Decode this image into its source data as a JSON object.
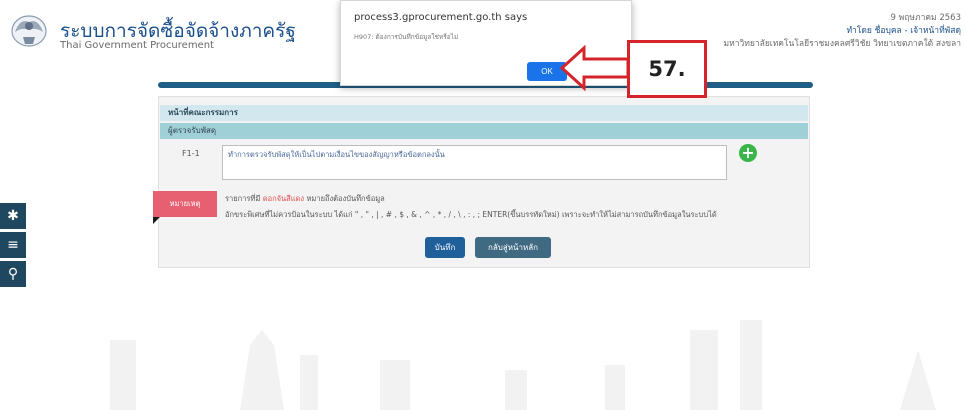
{
  "header": {
    "title": "ระบบการจัดซื้อจัดจ้างภาครัฐ",
    "subtitle": "Thai Government Procurement",
    "date": "9 พฤษภาคม 2563",
    "user": "ทำโดย ชื่อบุคล - เจ้าหน้าที่พัสดุ",
    "org": "มหาวิทยาลัยเทคโนโลยีราชมงคลศรีวิชัย วิทยาเขตภาคใต้ สงขลา"
  },
  "form": {
    "section_title": "หน้าที่คณะกรรมการ",
    "subsection_title": "ผู้ตรวจรับพัสดุ",
    "row_code": "F1-1",
    "duty_text": "ทำการตรวจรับพัสดุให้เป็นไปตามเงื่อนไขของสัญญาหรือข้อตกลงนั้น",
    "note_label": "หมายเหตุ",
    "note_line1_prefix": "รายการที่มี",
    "note_line1_red": "ดอกจันสีแดง",
    "note_line1_suffix": "หมายถึงต้องบันทึกข้อมูล",
    "note_line2": "อักขระพิเศษที่ไม่ควรป้อนในระบบ ได้แก่ \" , \" , | , # , $ , & , ^ , * , / , \\ , : , ; ENTER(ขึ้นบรรทัดใหม่) เพราะจะทำให้ไม่สามารถบันทึกข้อมูลในระบบได้",
    "save_label": "บันทึก",
    "home_label": "กลับสู่หน้าหลัก"
  },
  "dialog": {
    "title": "process3.gprocurement.go.th says",
    "message": "H907: ต้องการบันทึกข้อมูลใช่หรือไม่",
    "ok_label": "OK"
  },
  "annotation": {
    "step_label": "57.",
    "color": "#d6252a"
  },
  "sidebar_icons": [
    "gear-icon",
    "menu-icon",
    "search-icon"
  ],
  "colors": {
    "brand_blue": "#1a4f8a",
    "header_bar": "#1f5f85",
    "section_header": "#d3e7ee",
    "subsection_header": "#9fcfd7",
    "note_tag": "#e76072",
    "plus_green": "#39b54a",
    "ok_button": "#1a73e8"
  }
}
